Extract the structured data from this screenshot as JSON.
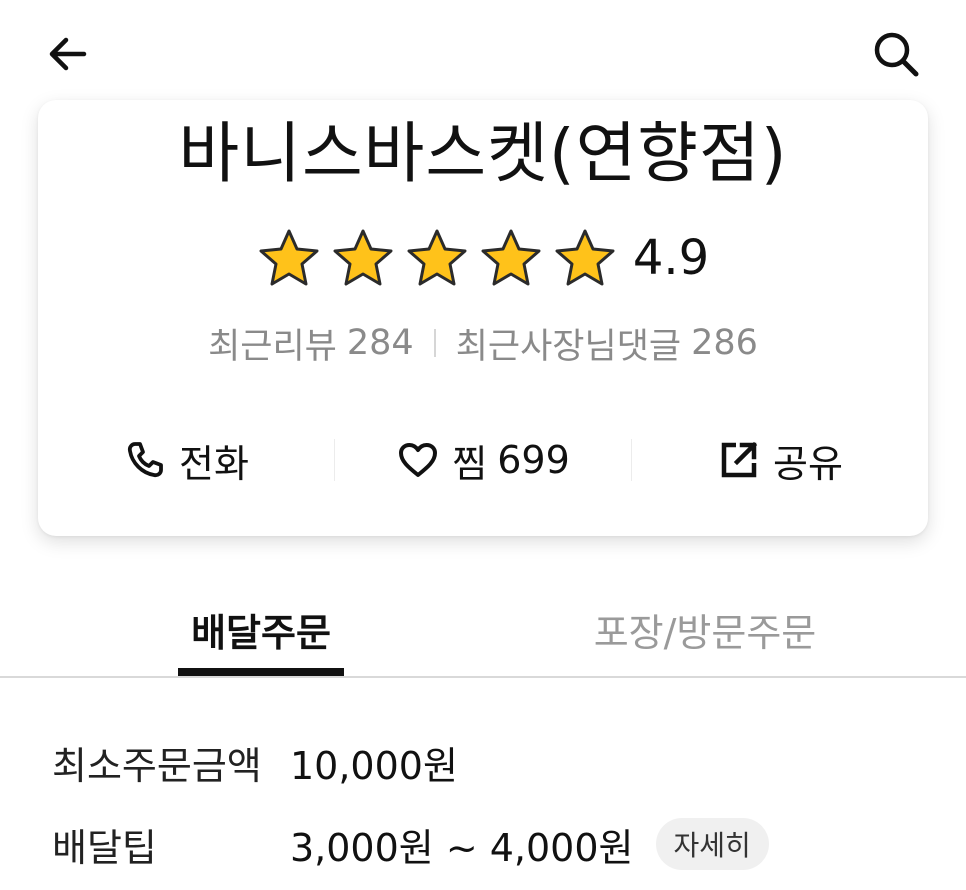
{
  "header": {
    "back_icon": "arrow-left-icon",
    "search_icon": "search-icon"
  },
  "shop": {
    "name": "바니스바스켓(연향점)",
    "rating": "4.9",
    "rating_stars": 5,
    "recent_reviews_label": "최근리뷰",
    "recent_reviews_count": "284",
    "owner_replies_label": "최근사장님댓글",
    "owner_replies_count": "286"
  },
  "actions": {
    "call_label": "전화",
    "like_label": "찜",
    "like_count": "699",
    "share_label": "공유"
  },
  "tabs": [
    {
      "label": "배달주문",
      "active": true
    },
    {
      "label": "포장/방문주문",
      "active": false
    }
  ],
  "delivery_info": {
    "min_order_label": "최소주문금액",
    "min_order_value": "10,000원",
    "tip_label": "배달팁",
    "tip_value": "3,000원 ~ 4,000원",
    "detail_button": "자세히"
  },
  "colors": {
    "star_fill": "#FFC21A",
    "active_tab": "#111111",
    "inactive_tab": "#9A9A9A",
    "muted_text": "#8A8A8A"
  }
}
